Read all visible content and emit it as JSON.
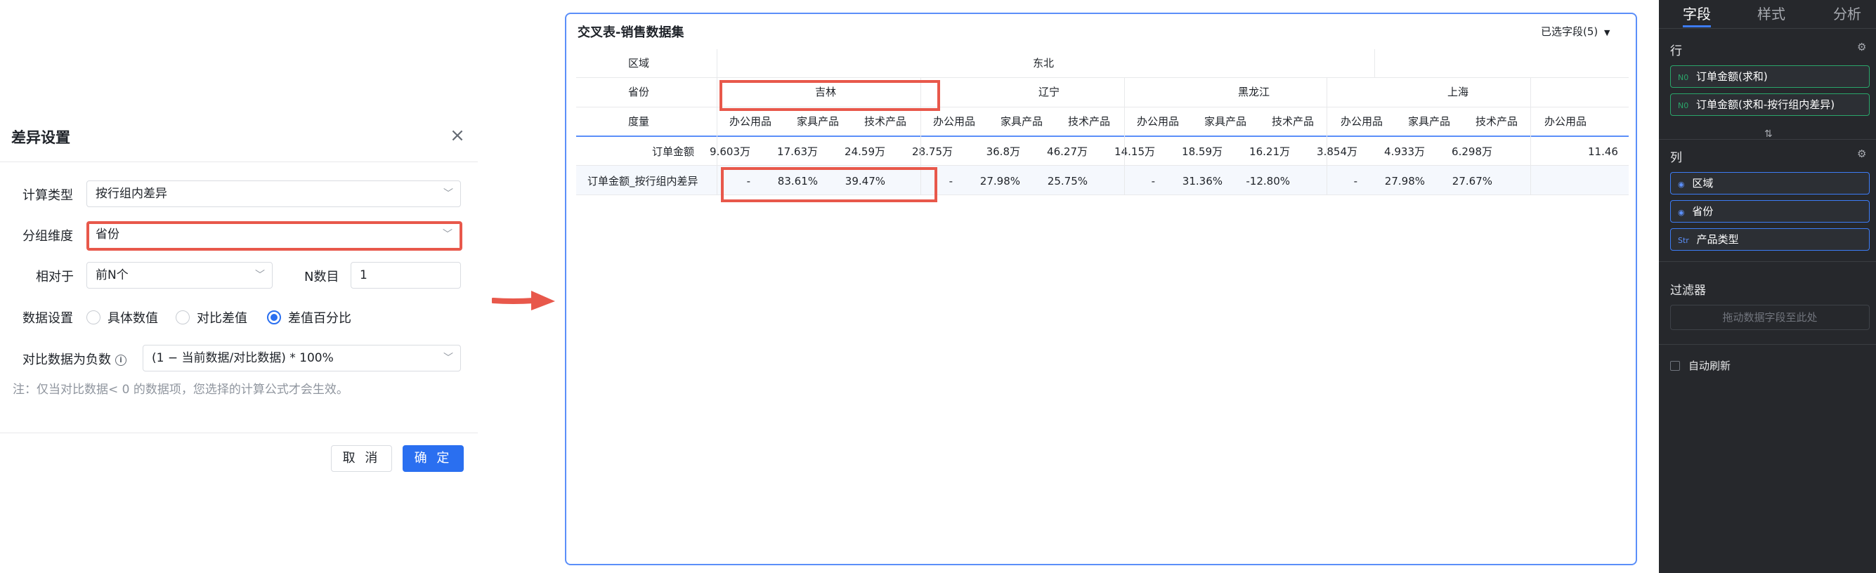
{
  "dialog": {
    "title": "差异设置",
    "calc_type": {
      "label": "计算类型",
      "value": "按行组内差异"
    },
    "group_dim": {
      "label": "分组维度",
      "value": "省份"
    },
    "relative": {
      "label": "相对于",
      "value": "前N个"
    },
    "n_count": {
      "label": "N数目",
      "value": "1"
    },
    "data_setting": {
      "label": "数据设置",
      "options": [
        "具体数值",
        "对比差值",
        "差值百分比"
      ],
      "selected": "差值百分比"
    },
    "negative": {
      "label": "对比数据为负数",
      "value": "(1 − 当前数据/对比数据) * 100%"
    },
    "note": "注：仅当对比数据< 0 的数据项，您选择的计算公式才会生效。",
    "cancel": "取 消",
    "ok": "确 定"
  },
  "panel": {
    "title": "交叉表-销售数据集",
    "selected_fields": "已选字段(5)",
    "header_labels": {
      "region": "区域",
      "province": "省份",
      "measure": "度量"
    },
    "region": "东北",
    "provinces": [
      "吉林",
      "辽宁",
      "黑龙江",
      "上海"
    ],
    "categories": [
      "办公用品",
      "家具产品",
      "技术产品",
      "办公用品",
      "家具产品",
      "技术产品",
      "办公用品",
      "家具产品",
      "技术产品",
      "办公用品",
      "家具产品",
      "技术产品",
      "办公用品"
    ],
    "rows": [
      {
        "label": "订单金额",
        "values": [
          "9.603万",
          "17.63万",
          "24.59万",
          "28.75万",
          "36.8万",
          "46.27万",
          "14.15万",
          "18.59万",
          "16.21万",
          "3.854万",
          "4.933万",
          "6.298万",
          "11.46"
        ]
      },
      {
        "label": "订单金额_按行组内差异",
        "values": [
          "-",
          "83.61%",
          "39.47%",
          "-",
          "27.98%",
          "25.75%",
          "-",
          "31.36%",
          "-12.80%",
          "-",
          "27.98%",
          "27.67%",
          ""
        ]
      }
    ]
  },
  "sidebar": {
    "tabs": [
      "字段",
      "样式",
      "分析"
    ],
    "rows_title": "行",
    "row_fields": [
      {
        "tag": "N0",
        "label": "订单金额(求和)"
      },
      {
        "tag": "N0",
        "label": "订单金额(求和-按行组内差异)"
      }
    ],
    "cols_title": "列",
    "col_fields": [
      {
        "tag": "◉",
        "label": "区域"
      },
      {
        "tag": "◉",
        "label": "省份"
      },
      {
        "tag": "Str",
        "label": "产品类型"
      }
    ],
    "filter_title": "过滤器",
    "filter_placeholder": "拖动数据字段至此处",
    "auto_refresh": "自动刷新"
  },
  "colors": {
    "accent": "#2a6ff0",
    "highlight": "#e8584b",
    "sidebar_bg": "#26282c"
  }
}
